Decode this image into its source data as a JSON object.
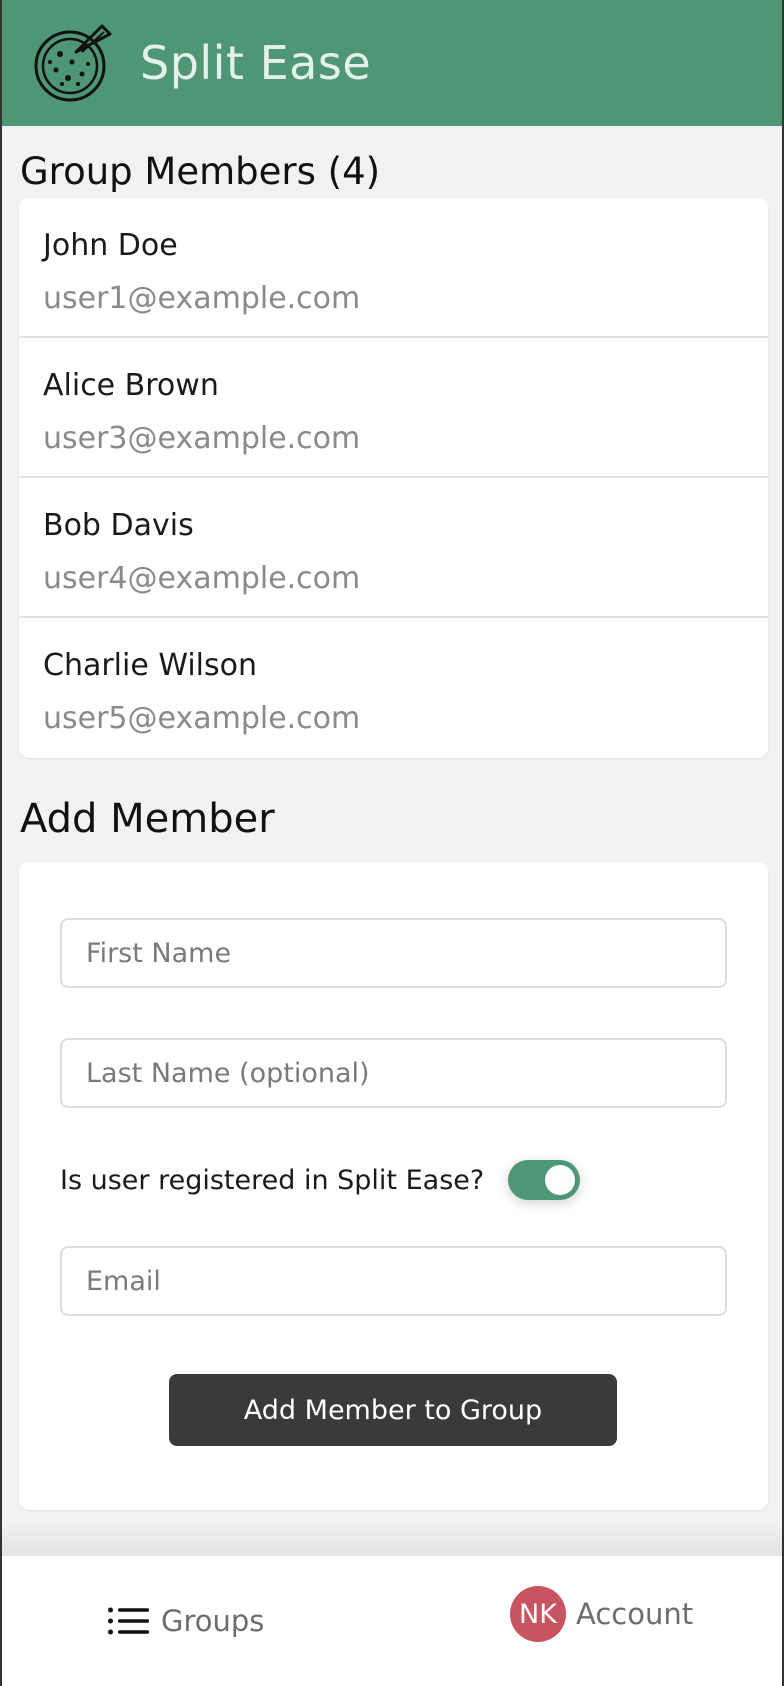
{
  "header": {
    "title": "Split Ease",
    "logo_icon": "pizza-icon",
    "color": "#4f9675"
  },
  "members": {
    "title": "Group Members (4)",
    "items": [
      {
        "name": "John Doe",
        "email": "user1@example.com"
      },
      {
        "name": "Alice Brown",
        "email": "user3@example.com"
      },
      {
        "name": "Bob Davis",
        "email": "user4@example.com"
      },
      {
        "name": "Charlie Wilson",
        "email": "user5@example.com"
      }
    ]
  },
  "add_member": {
    "title": "Add Member",
    "first_name_placeholder": "First Name",
    "last_name_placeholder": "Last Name (optional)",
    "registered_label": "Is user registered in Split Ease?",
    "registered_toggle_on": true,
    "email_placeholder": "Email",
    "submit_label": "Add Member to Group"
  },
  "nav": {
    "groups_label": "Groups",
    "groups_icon": "list-icon",
    "account_label": "Account",
    "avatar_initials": "NK",
    "avatar_color": "#c85460"
  }
}
